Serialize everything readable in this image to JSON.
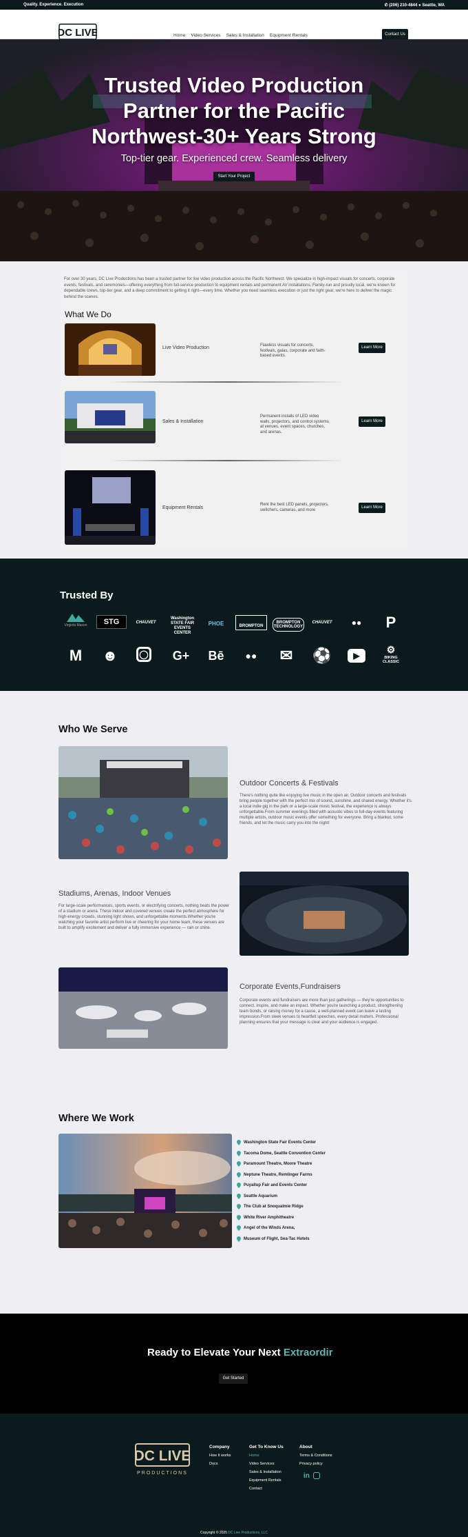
{
  "topbar": {
    "tagline": "Quality. Experience. Execution",
    "phone": "(206) 210-4844",
    "location": "Seattle, WA"
  },
  "nav": {
    "logo_text": "DC LIVE",
    "logo_sub": "PRODUCTIONS",
    "links": [
      "Home",
      "Video Services",
      "Sales & Installation",
      "Equipment Rentals"
    ],
    "contact": "Contact Us"
  },
  "hero": {
    "title": "Trusted Video Production Partner for the Pacific Northwest-30+ Years Strong",
    "subtitle": "Top-tier gear. Experienced crew. Seamless delivery",
    "cta": "Start Your Project"
  },
  "intro": "For over 30 years, DC Live Productions has been a trusted partner for live video production across the Pacific Northwest. We specialize in high-impact visuals for concerts, corporate events, festivals, and ceremonies—offering everything from full-service production to equipment rentals and permanent AV installations. Family-run and proudly local, we're known for dependable crews, top-tier gear, and a deep commitment to getting it right—every time. Whether you need seamless execution or just the right gear, we're here to deliver the magic behind the scenes.",
  "what_we_do": {
    "title": "What We Do",
    "services": [
      {
        "name": "Live Video Production",
        "desc": "Flawless visuals for concerts, festivals, galas, corporate and faith-based events.",
        "btn": "Learn More"
      },
      {
        "name": "Sales & Installation",
        "desc": "Permanent installs of LED video walls, projectors, and control systems at venues, event spaces, churches, and arenas.",
        "btn": "Learn More"
      },
      {
        "name": "Equipment Rentals",
        "desc": "Rent the best LED panels, projectors, switchers, cameras, and more",
        "btn": "Learn More"
      }
    ]
  },
  "trusted": {
    "title": "Trusted By",
    "logos": [
      "Virginia Mason",
      "STG",
      "CHAUVET",
      "Washington STATE FAIR EVENTS CENTER",
      "PHOE",
      "BROMPTON",
      "BROMPTON TECHNOLOGY",
      "CHAUVET",
      "BIKING CLASSIC"
    ]
  },
  "who": {
    "title": "Who We Serve",
    "items": [
      {
        "heading": "Outdoor Concerts & Festivals",
        "text": "There's nothing quite like enjoying live music in the open air. Outdoor concerts and festivals bring people together with the perfect mix of sound, sunshine, and shared energy. Whether it's a local indie gig in the park or a large-scale music festival, the experience is always unforgettable.From summer evenings filled with acoustic vibes to full-day events featuring multiple artists, outdoor music events offer something for everyone. Bring a blanket, some friends, and let the music carry you into the night!"
      },
      {
        "heading": "Stadiums, Arenas, Indoor Venues",
        "text": "For large-scale performances, sports events, or electrifying concerts, nothing beats the power of a stadium or arena. These indoor and covered venues create the perfect atmosphere for high-energy crowds, stunning light shows, and unforgettable moments.Whether you're watching your favorite artist perform live or cheering for your home team, these venues are built to amplify excitement and deliver a fully immersive experience — rain or shine."
      },
      {
        "heading": "Corporate Events,Fundraisers",
        "text": "Corporate events and fundraisers are more than just gatherings — they're opportunities to connect, inspire, and make an impact. Whether you're launching a product, strengthening team bonds, or raising money for a cause, a well-planned event can leave a lasting impression.From sleek venues to heartfelt speeches, every detail matters. Professional planning ensures that your message is clear and your audience is engaged."
      }
    ]
  },
  "where": {
    "title": "Where We Work",
    "locations": [
      "Washington State Fair Events Center",
      "Tacoma Dome, Seattle Convention Center",
      "Paramount Theatre, Moore Theatre",
      "Neptune Theatre, Remlinger Farms",
      "Puyallup Fair and Events Center",
      "Seattle Aquarium",
      "The Club at Snoqualmie Ridge",
      "White River Amphitheatre",
      "Angel of the Winds Arena,",
      "Museum of Flight, Sea-Tac Hotels"
    ]
  },
  "ready": {
    "title": "Ready to Elevate Your Next",
    "accent": "Extraordir",
    "btn": "Get Started"
  },
  "footer": {
    "company": {
      "title": "Company",
      "links": [
        "How It works",
        "Docs"
      ]
    },
    "get_to_know": {
      "title": "Get To Know Us",
      "links": [
        "Home",
        "Video Services",
        "Sales & Installation",
        "Equipment Rentals",
        "Contact"
      ]
    },
    "about": {
      "title": "About",
      "links": [
        "Terms & Conditions",
        "Privacy policy"
      ]
    },
    "copyright": "Copyright © 2025",
    "copyright_link": "DC Live Productions, LLC"
  },
  "colors": {
    "dark": "#0b1a1c",
    "accent": "#5fb4b4",
    "page_bg": "#eeeef3"
  }
}
